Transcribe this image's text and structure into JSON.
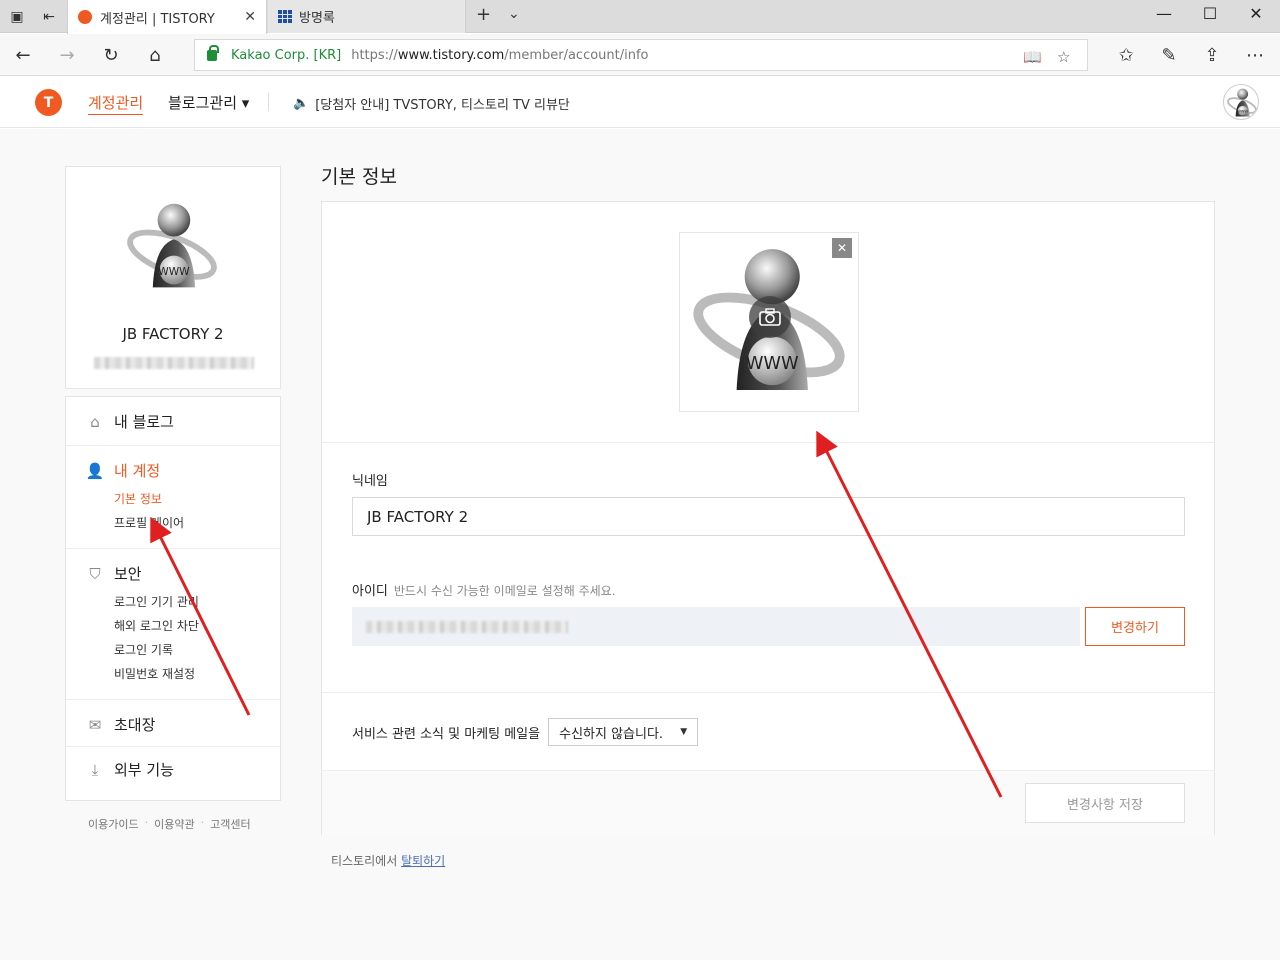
{
  "browser": {
    "tabs": [
      {
        "title": "계정관리 | TISTORY",
        "active": true
      },
      {
        "title": "방명록",
        "active": false
      }
    ],
    "url": {
      "org": "Kakao Corp. [KR]",
      "scheme": "https://",
      "host": "www.tistory.com",
      "path": "/member/account/info"
    }
  },
  "header": {
    "logo_letter": "T",
    "account_menu": "계정관리",
    "blog_menu": "블로그관리 ▾",
    "notice": "[당첨자 안내] TVSTORY, 티스토리 TV 리뷰단"
  },
  "profile": {
    "name": "JB FACTORY 2"
  },
  "sidebar": {
    "my_blog": "내 블로그",
    "my_account": "내 계정",
    "account_items": [
      "기본 정보",
      "프로필 레이어"
    ],
    "security": "보안",
    "security_items": [
      "로그인 기기 관리",
      "해외 로그인 차단",
      "로그인 기록",
      "비밀번호 재설정"
    ],
    "invite": "초대장",
    "external": "외부 기능"
  },
  "footer_links": [
    "이용가이드",
    "이용약관",
    "고객센터"
  ],
  "main": {
    "section_title": "기본 정보",
    "nickname_label": "닉네임",
    "nickname_value": "JB FACTORY 2",
    "id_label": "아이디",
    "id_hint": "반드시 수신 가능한 이메일로 설정해 주세요.",
    "change_button": "변경하기",
    "marketing_label": "서비스 관련 소식 및 마케팅 메일을",
    "marketing_option": "수신하지 않습니다.",
    "save_button": "변경사항 저장",
    "withdraw_prefix": "티스토리에서 ",
    "withdraw_link": "탈퇴하기"
  },
  "colors": {
    "accent": "#f05a22",
    "arrow": "#e02020"
  }
}
